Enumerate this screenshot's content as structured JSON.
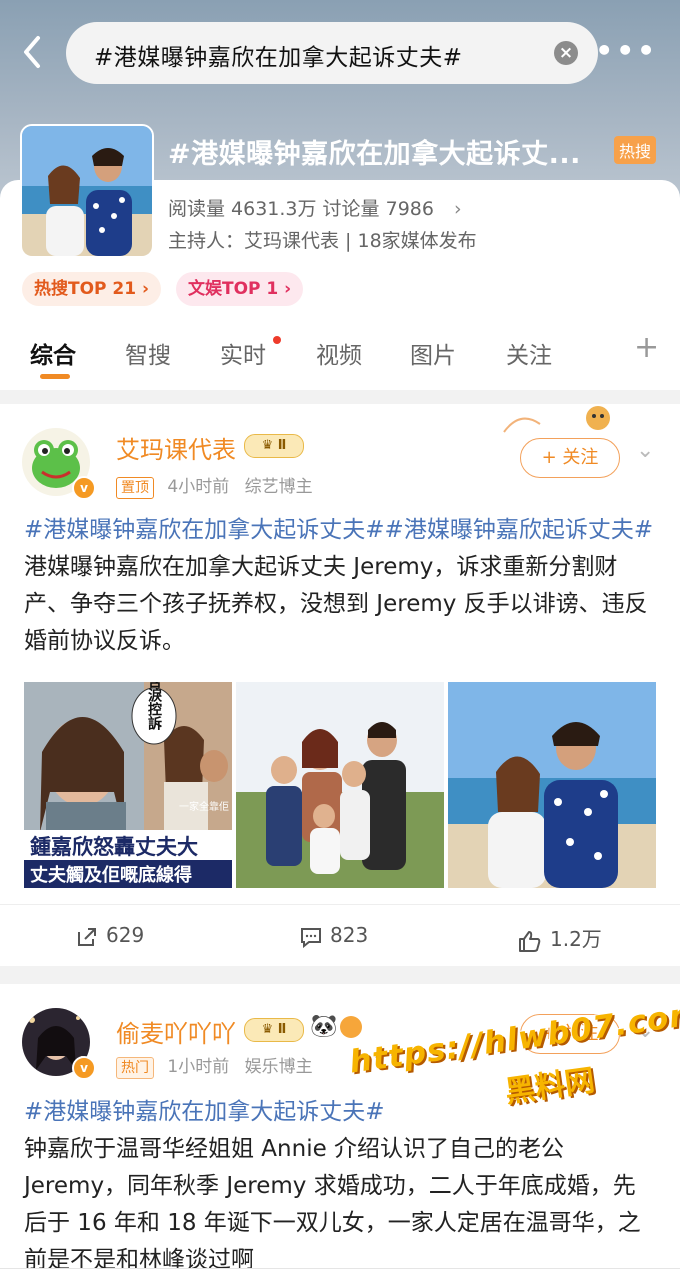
{
  "header": {
    "search_query": "#港媒曝钟嘉欣在加拿大起诉丈夫#",
    "back_icon": "chevron-left-icon",
    "clear_icon": "clear-icon",
    "more_icon": "more-icon"
  },
  "topic": {
    "title": "#港媒曝钟嘉欣在加拿大起诉丈...",
    "hot_label": "热搜",
    "stats": "阅读量 4631.3万  讨论量 7986",
    "host": "主持人：艾玛课代表 | 18家媒体发布",
    "rank_hot": "热搜TOP 21 ›",
    "rank_ent": "文娱TOP 1 ›"
  },
  "tabs": [
    "综合",
    "智搜",
    "实时",
    "视频",
    "图片",
    "关注"
  ],
  "posts": [
    {
      "username": "艾玛课代表",
      "level": "Ⅱ",
      "tag": "置顶",
      "time": "4小时前",
      "role": "综艺博主",
      "follow": "+ 关注",
      "topic1": "#港媒曝钟嘉欣在加拿大起诉丈夫##港媒曝钟嘉欣起诉丈夫#",
      "body": " 港媒曝钟嘉欣在加拿大起诉丈夫 Jeremy，诉求重新分割财产、争夺三个孩子抚养权，没想到 Jeremy 反手以诽谤、违反婚前协议反诉。",
      "img1_bubble": "含淚控訴",
      "img1_side": "一家全靠佢",
      "img1_caption1": "鍾嘉欣怒轟丈夫大",
      "img1_caption2": "丈夫觸及佢嘅底線得",
      "reposts": "629",
      "comments": "823",
      "likes": "1.2万"
    },
    {
      "username": "偷麦吖吖吖",
      "level": "Ⅱ",
      "tag": "热门",
      "time": "1小时前",
      "role": "娱乐博主",
      "follow": "+ 关注",
      "topic1": "#港媒曝钟嘉欣在加拿大起诉丈夫#",
      "body": "钟嘉欣于温哥华经姐姐 Annie 介绍认识了自己的老公 Jeremy，同年秋季 Jeremy 求婚成功，二人于年底成婚，先后于 16 年和 18 年诞下一双儿女，一家人定居在温哥华，之前是不是和林峰谈过啊"
    }
  ],
  "watermark": {
    "url": "https://hlwb07.com",
    "name": "黑料网"
  },
  "colors": {
    "accent": "#f08a24",
    "topic_blue": "#4a74b8"
  }
}
